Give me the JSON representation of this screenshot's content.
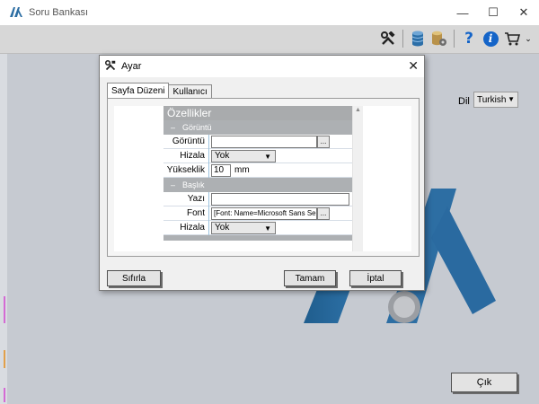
{
  "app": {
    "title": "Soru Bankası",
    "minimize": "—",
    "maximize": "☐",
    "close": "✕"
  },
  "toolbar": {
    "icons": [
      "tools-icon",
      "database-icon",
      "database-settings-icon",
      "help-icon",
      "info-icon",
      "cart-icon"
    ],
    "help_glyph": "?",
    "info_glyph": "i",
    "overflow": "⌄"
  },
  "language": {
    "label": "Dil",
    "selected": "Turkish"
  },
  "exit_button": "Çık",
  "dialog": {
    "title": "Ayar",
    "close": "✕",
    "tabs": [
      {
        "label": "Sayfa Düzeni",
        "active": true
      },
      {
        "label": "Kullanıcı",
        "active": false
      }
    ],
    "property_grid": {
      "header": "Özellikler",
      "categories": [
        {
          "name": "Görüntü",
          "rows": [
            {
              "name": "Görüntü",
              "value": "",
              "editor": "text-dots"
            },
            {
              "name": "Hizala",
              "value": "Yok",
              "editor": "select"
            },
            {
              "name": "Yükseklik",
              "value": "10",
              "unit": "mm",
              "editor": "number"
            }
          ]
        },
        {
          "name": "Başlık",
          "rows": [
            {
              "name": "Yazı",
              "value": "",
              "editor": "text"
            },
            {
              "name": "Font",
              "value": "[Font: Name=Microsoft Sans Serif, S",
              "editor": "text-dots"
            },
            {
              "name": "Hizala",
              "value": "Yok",
              "editor": "select"
            }
          ]
        }
      ],
      "collapse_glyph": "–",
      "dots": "..."
    },
    "buttons": {
      "reset": "Sıfırla",
      "ok": "Tamam",
      "cancel": "İptal"
    }
  },
  "colors": {
    "logo_blue": "#2d6ea3",
    "accent_blue": "#1464c8",
    "background": "#c6cad1"
  }
}
